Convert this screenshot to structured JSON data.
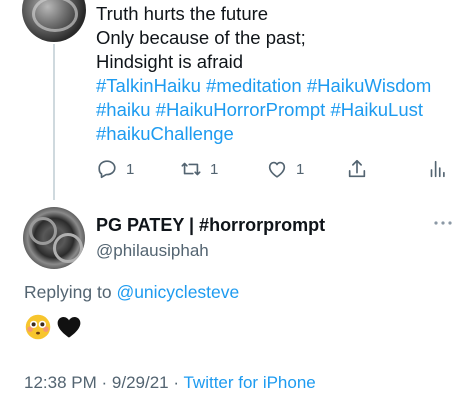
{
  "previous_tweet": {
    "text_lines": [
      "Truth hurts the future",
      "Only because of the past;",
      "Hindsight is afraid"
    ],
    "hashtags": [
      "#TalkinHaiku",
      "#meditation",
      "#HaikuWisdom",
      "#haiku",
      "#HaikuHorrorPrompt",
      "#HaikuLust",
      "#haikuChallenge"
    ],
    "actions": {
      "reply_count": "1",
      "retweet_count": "1",
      "like_count": "1"
    }
  },
  "reply_tweet": {
    "display_name": "PG PATEY | #horrorprompt",
    "handle": "@philausiphah",
    "replying_label": "Replying to",
    "replying_to": "@unicyclesteve",
    "emojis": [
      "flushed-face",
      "black-heart"
    ],
    "time": "12:38 PM",
    "separator": "·",
    "date": "9/29/21",
    "source": "Twitter for iPhone"
  },
  "colors": {
    "link": "#1d9bf0",
    "secondary_text": "#536471",
    "thread_line": "#cfd9de"
  }
}
